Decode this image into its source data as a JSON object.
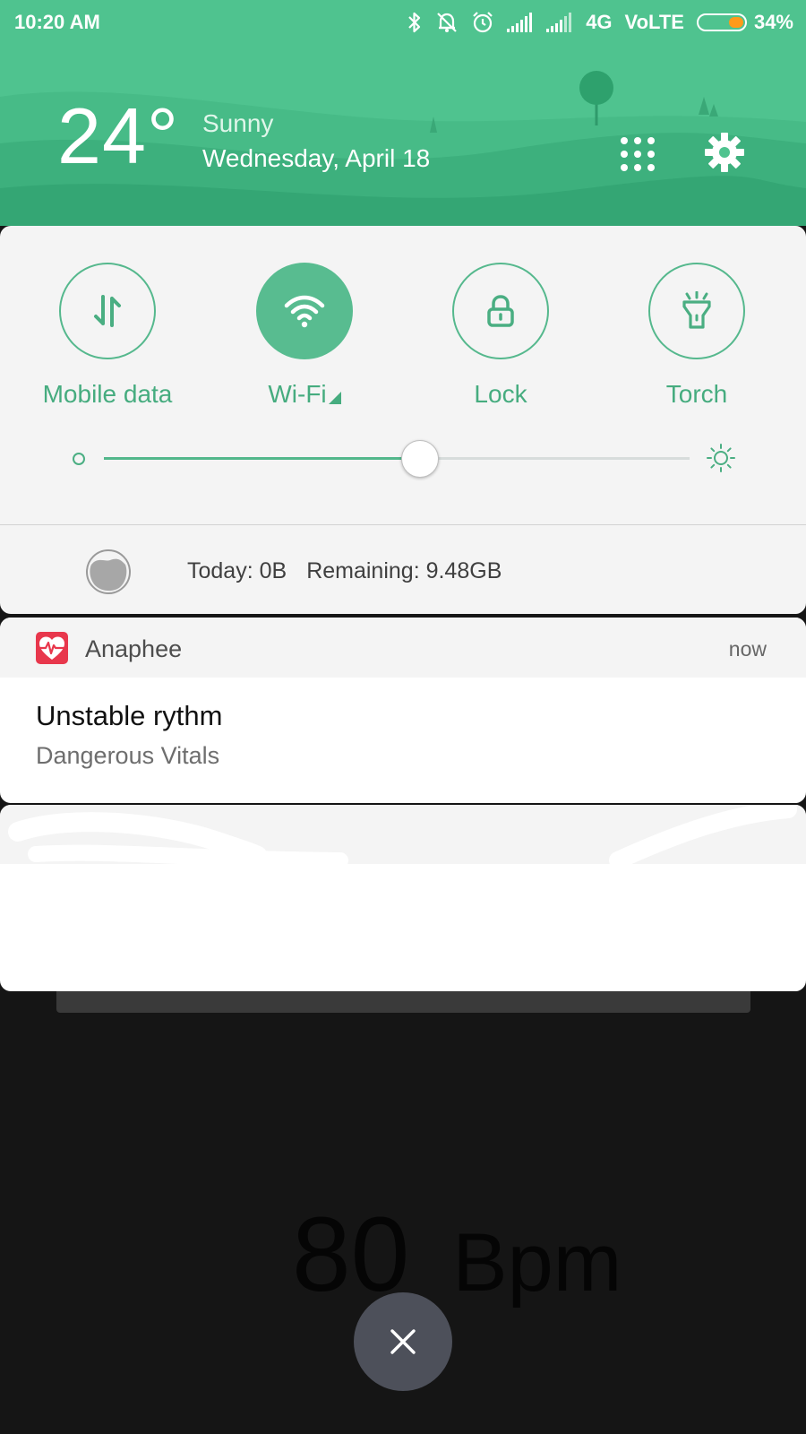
{
  "status_bar": {
    "time": "10:20 AM",
    "network": "4G",
    "volte": "VoLTE",
    "battery_percent": "34%",
    "icons": [
      "bluetooth-icon",
      "mute-icon",
      "alarm-icon",
      "signal-icon",
      "signal-icon"
    ]
  },
  "weather": {
    "temperature": "24°",
    "condition": "Sunny",
    "date": "Wednesday, April 18"
  },
  "header_buttons": [
    "apps-grid-icon",
    "gear-icon"
  ],
  "quick_settings": {
    "tiles": [
      {
        "label": "Mobile data",
        "icon": "mobile-data-icon",
        "active": false
      },
      {
        "label": "Wi-Fi",
        "icon": "wifi-icon",
        "active": true
      },
      {
        "label": "Lock",
        "icon": "lock-icon",
        "active": false
      },
      {
        "label": "Torch",
        "icon": "torch-icon",
        "active": false
      }
    ],
    "brightness_level": 0.54
  },
  "data_usage": {
    "today": "Today: 0B",
    "remaining": "Remaining: 9.48GB"
  },
  "notification": {
    "app_name": "Anaphee",
    "time": "now",
    "title": "Unstable rythm",
    "body": "Dangerous Vitals"
  },
  "background_app": {
    "heart_rate_value": "80",
    "heart_rate_unit": "Bpm"
  },
  "colors": {
    "accent": "#4fc38f",
    "tile_border": "#55b88d",
    "label": "#46ac7f",
    "battery_fill": "#ff9a1a",
    "app_icon": "#e8374c",
    "close_button": "#4d505a"
  }
}
